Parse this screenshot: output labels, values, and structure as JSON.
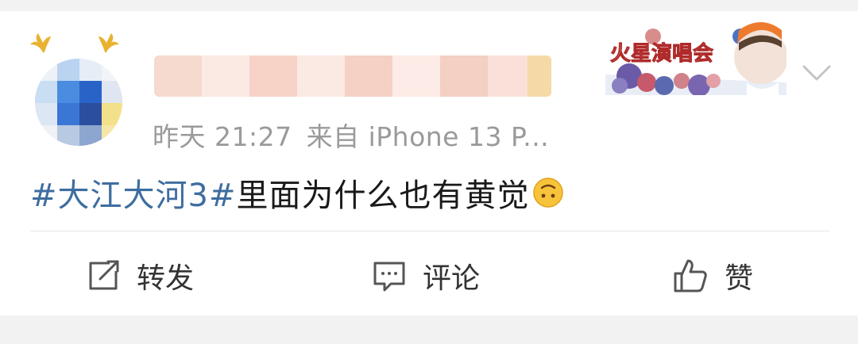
{
  "post": {
    "username": "",
    "time": "昨天 21:27",
    "source": "来自 iPhone 13 P...",
    "hashtag": "#大江大河3#",
    "text": "里面为什么也有黄觉",
    "emoji": "upside-down-face-emoji"
  },
  "badge": {
    "text": "火星演唱会"
  },
  "actions": {
    "repost": "转发",
    "comment": "评论",
    "like": "赞"
  },
  "colors": {
    "hashtag": "#3e6da0",
    "meta": "#9a9a9a",
    "text": "#1a1a1a",
    "background": "#f2f2f2"
  }
}
